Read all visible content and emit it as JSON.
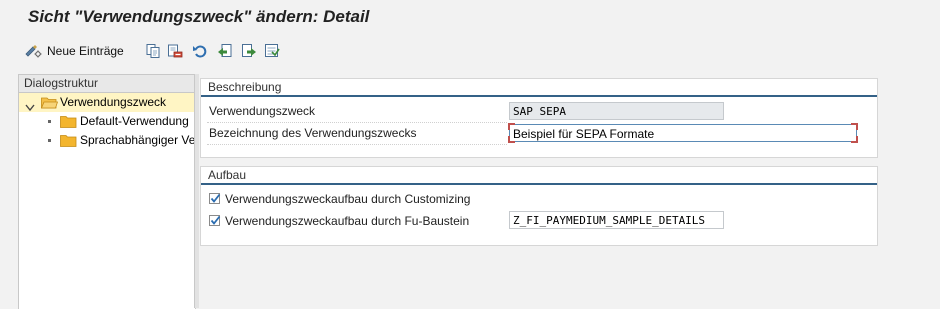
{
  "window": {
    "title": "Sicht \"Verwendungszweck\" ändern: Detail"
  },
  "toolbar": {
    "new_entries_label": "Neue Einträge",
    "icons": [
      "display-change-icon",
      "copy-icon",
      "delete-icon",
      "undo-icon",
      "previous-entry-icon",
      "next-entry-icon",
      "select-all-icon"
    ]
  },
  "dialog": {
    "header": "Dialogstruktur",
    "items": [
      {
        "label": "Verwendungszweck",
        "selected": true,
        "expanded": true
      },
      {
        "label": "Default-Verwendung",
        "selected": false
      },
      {
        "label": "Sprachabhängiger Ve",
        "selected": false
      }
    ]
  },
  "beschreibung": {
    "title": "Beschreibung",
    "purpose_label": "Verwendungszweck",
    "purpose_value": "SAP SEPA",
    "desc_label": "Bezeichnung des Verwendungszwecks",
    "desc_value": "Beispiel für SEPA Formate"
  },
  "aufbau": {
    "title": "Aufbau",
    "customizing_label": "Verwendungszweckaufbau durch Customizing",
    "customizing_checked": true,
    "fub_label": "Verwendungszweckaufbau durch Fu-Baustein",
    "fub_checked": true,
    "fub_value": "Z_FI_PAYMEDIUM_SAMPLE_DETAILS"
  },
  "colors": {
    "accent": "#346187",
    "selection": "#fff5c4",
    "folder": "#f0b020",
    "required_corner": "#c0504d"
  }
}
